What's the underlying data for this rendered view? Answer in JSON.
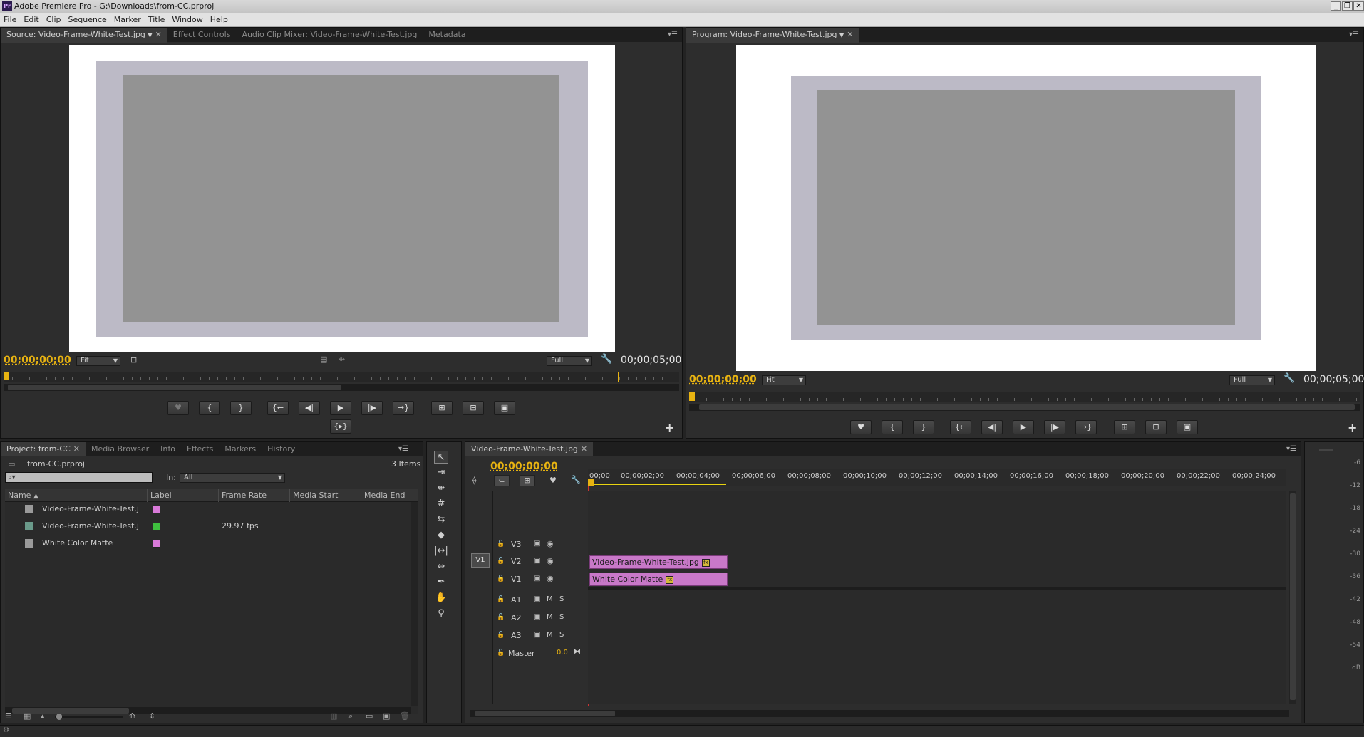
{
  "window": {
    "title": "Adobe Premiere Pro - G:\\Downloads\\from-CC.prproj",
    "app_icon": "Pr"
  },
  "menu": [
    "File",
    "Edit",
    "Clip",
    "Sequence",
    "Marker",
    "Title",
    "Window",
    "Help"
  ],
  "source": {
    "tabs": [
      "Source: Video-Frame-White-Test.jpg",
      "Effect Controls",
      "Audio Clip Mixer: Video-Frame-White-Test.jpg",
      "Metadata"
    ],
    "timecode": "00;00;00;00",
    "duration": "00;00;05;00",
    "zoom": "Fit",
    "resolution": "Full"
  },
  "program": {
    "tabs": [
      "Program: Video-Frame-White-Test.jpg"
    ],
    "timecode": "00;00;00;00",
    "duration": "00;00;05;00",
    "zoom": "Fit",
    "resolution": "Full"
  },
  "project": {
    "tabs": [
      "Project: from-CC",
      "Media Browser",
      "Info",
      "Effects",
      "Markers",
      "History"
    ],
    "file": "from-CC.prproj",
    "count": "3 Items",
    "in_label": "In:",
    "in_value": "All",
    "columns": [
      "Name",
      "Label",
      "Frame Rate",
      "Media Start",
      "Media End"
    ],
    "items": [
      {
        "name": "Video-Frame-White-Test.j",
        "label_color": "#d97ad9",
        "frame_rate": ""
      },
      {
        "name": "Video-Frame-White-Test.j",
        "label_color": "#3fbf3f",
        "frame_rate": "29.97 fps"
      },
      {
        "name": "White Color Matte",
        "label_color": "#d97ad9",
        "frame_rate": ""
      }
    ]
  },
  "timeline": {
    "tab": "Video-Frame-White-Test.jpg",
    "timecode": "00;00;00;00",
    "ruler": [
      "00;00",
      "00;00;02;00",
      "00;00;04;00",
      "00;00;06;00",
      "00;00;08;00",
      "00;00;10;00",
      "00;00;12;00",
      "00;00;14;00",
      "00;00;16;00",
      "00;00;18;00",
      "00;00;20;00",
      "00;00;22;00",
      "00;00;24;00"
    ],
    "source_patch": "V1",
    "video_tracks": [
      "V3",
      "V2",
      "V1"
    ],
    "audio_tracks": [
      "A1",
      "A2",
      "A3"
    ],
    "mute": "M",
    "solo": "S",
    "master": "Master",
    "master_value": "0.0",
    "clips": [
      {
        "track": "V2",
        "name": "Video-Frame-White-Test.jpg"
      },
      {
        "track": "V1",
        "name": "White Color Matte"
      }
    ]
  },
  "meter": {
    "labels": [
      "-6",
      "-12",
      "-18",
      "-24",
      "-30",
      "-36",
      "-42",
      "-48",
      "-54",
      "dB"
    ]
  }
}
